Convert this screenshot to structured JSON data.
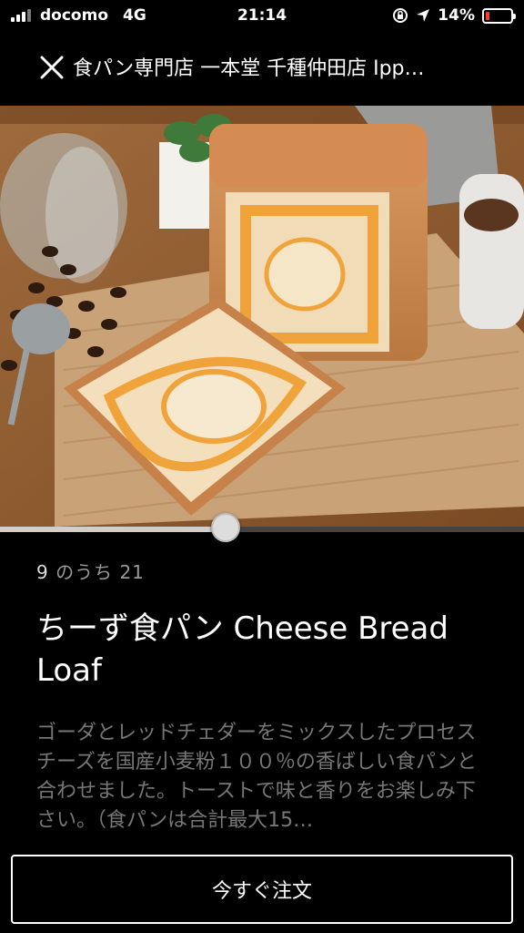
{
  "status_bar": {
    "carrier": "docomo",
    "network": "4G",
    "time": "21:14",
    "battery_percent": "14%",
    "battery_level": 0.14,
    "battery_color": "#ff3b30"
  },
  "header": {
    "title": "食パン専門店 一本堂 千種仲田店 Ipp…",
    "close_icon": "close-icon"
  },
  "carousel": {
    "current": "9",
    "separator": "のうち",
    "total": "21",
    "progress": 0.43
  },
  "item": {
    "title": "ちーず食パン Cheese Bread Loaf",
    "description": "ゴーダとレッドチェダーをミックスしたプロセスチーズを国産小麦粉１００％の香ばしい食パンと合わせました。トーストで味と香りをお楽しみ下さい。（食パンは合計最大15…"
  },
  "actions": {
    "order_label": "今すぐ注文"
  }
}
